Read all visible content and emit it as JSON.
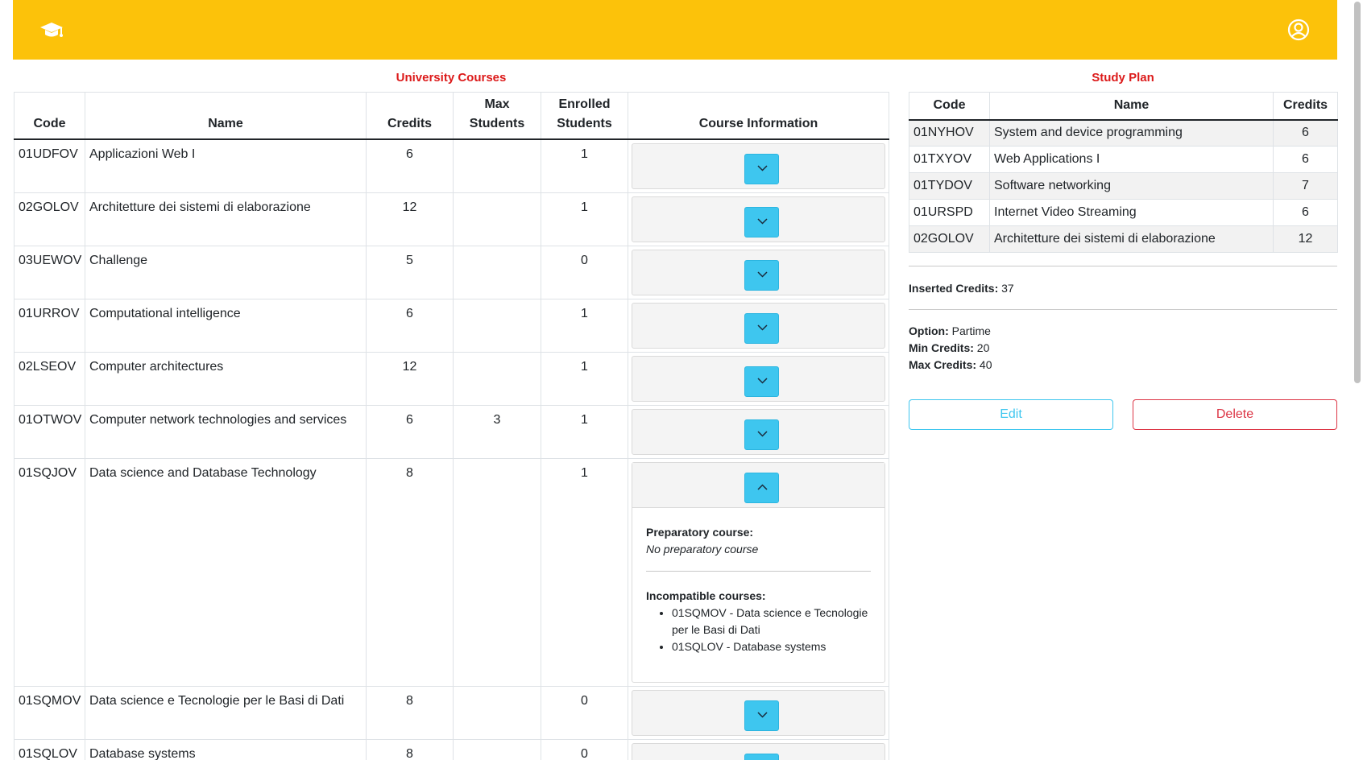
{
  "navbar": {
    "logo_icon": "graduation-cap-icon",
    "user_icon": "user-circle-icon",
    "bg_color": "#fcc20a"
  },
  "courses": {
    "title": "University Courses",
    "headers": {
      "code": "Code",
      "name": "Name",
      "credits": "Credits",
      "max_students": "Max Students",
      "enrolled": "Enrolled Students",
      "info": "Course Information"
    },
    "rows": [
      {
        "code": "01UDFOV",
        "name": "Applicazioni Web I",
        "credits": "6",
        "max": "",
        "enrolled": "1"
      },
      {
        "code": "02GOLOV",
        "name": "Architetture dei sistemi di elaborazione",
        "credits": "12",
        "max": "",
        "enrolled": "1"
      },
      {
        "code": "03UEWOV",
        "name": "Challenge",
        "credits": "5",
        "max": "",
        "enrolled": "0"
      },
      {
        "code": "01URROV",
        "name": "Computational intelligence",
        "credits": "6",
        "max": "",
        "enrolled": "1"
      },
      {
        "code": "02LSEOV",
        "name": "Computer architectures",
        "credits": "12",
        "max": "",
        "enrolled": "1"
      },
      {
        "code": "01OTWOV",
        "name": "Computer network technologies and services",
        "credits": "6",
        "max": "3",
        "enrolled": "1"
      },
      {
        "code": "01SQJOV",
        "name": "Data science and Database Technology",
        "credits": "8",
        "max": "",
        "enrolled": "1"
      },
      {
        "code": "01SQMOV",
        "name": "Data science e Tecnologie per le Basi di Dati",
        "credits": "8",
        "max": "",
        "enrolled": "0"
      },
      {
        "code": "01SQLOV",
        "name": "Database systems",
        "credits": "8",
        "max": "",
        "enrolled": "0"
      }
    ],
    "expanded": {
      "preparatory_label": "Preparatory course:",
      "preparatory_value": "No preparatory course",
      "incompatible_label": "Incompatible courses:",
      "incompatible": [
        "01SQMOV - Data science e Tecnologie per le Basi di Dati",
        "01SQLOV - Database systems"
      ]
    }
  },
  "plan": {
    "title": "Study Plan",
    "headers": {
      "code": "Code",
      "name": "Name",
      "credits": "Credits"
    },
    "rows": [
      {
        "code": "01NYHOV",
        "name": "System and device programming",
        "credits": "6"
      },
      {
        "code": "01TXYOV",
        "name": "Web Applications I",
        "credits": "6"
      },
      {
        "code": "01TYDOV",
        "name": "Software networking",
        "credits": "7"
      },
      {
        "code": "01URSPD",
        "name": "Internet Video Streaming",
        "credits": "6"
      },
      {
        "code": "02GOLOV",
        "name": "Architetture dei sistemi di elaborazione",
        "credits": "12"
      }
    ],
    "inserted_label": "Inserted Credits:",
    "inserted_value": "37",
    "option_label": "Option:",
    "option_value": "Partime",
    "min_label": "Min Credits:",
    "min_value": "20",
    "max_label": "Max Credits:",
    "max_value": "40",
    "edit_label": "Edit",
    "delete_label": "Delete"
  }
}
